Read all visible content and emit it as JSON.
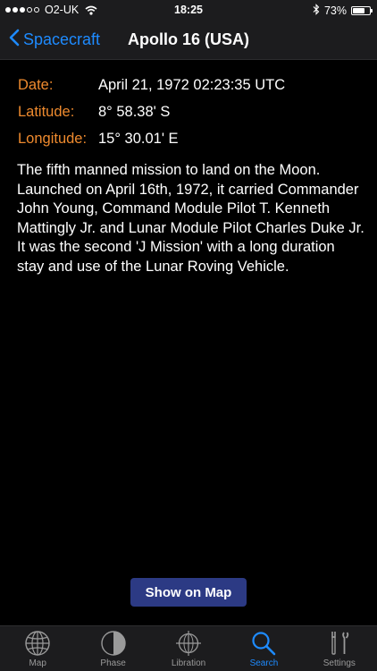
{
  "status_bar": {
    "carrier": "O2-UK",
    "time": "18:25",
    "battery": "73%",
    "battery_level": 0.73,
    "signal_bars_filled": 3,
    "signal_bars_total": 5
  },
  "nav": {
    "back_label": "Spacecraft",
    "title": "Apollo 16 (USA)"
  },
  "info": [
    {
      "label": "Date:",
      "value": "April 21, 1972 02:23:35 UTC"
    },
    {
      "label": "Latitude:",
      "value": "8° 58.38' S"
    },
    {
      "label": "Longitude:",
      "value": "15° 30.01' E"
    }
  ],
  "description": "The fifth manned mission to land on the Moon. Launched on April 16th, 1972, it carried Commander John Young, Command Module Pilot T. Kenneth Mattingly Jr. and Lunar Module Pilot Charles Duke Jr. It was the second 'J Mission' with a long duration stay and use of the Lunar Roving Vehicle.",
  "map_button_label": "Show on Map",
  "tabs": [
    {
      "label": "Map",
      "icon": "globe-icon",
      "active": false
    },
    {
      "label": "Phase",
      "icon": "moon-phase-icon",
      "active": false
    },
    {
      "label": "Libration",
      "icon": "libration-icon",
      "active": false
    },
    {
      "label": "Search",
      "icon": "search-icon",
      "active": true
    },
    {
      "label": "Settings",
      "icon": "settings-tools-icon",
      "active": false
    }
  ],
  "colors": {
    "accent": "#1e8bff",
    "label": "#ee8a2e",
    "button": "#2c3a84",
    "background": "#000000",
    "bar": "#1c1c1e"
  }
}
